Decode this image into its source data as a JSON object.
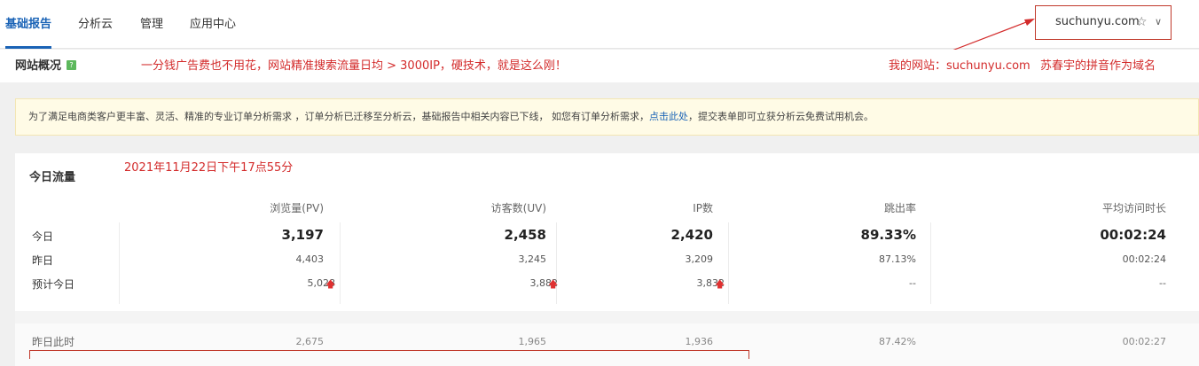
{
  "nav": {
    "tabs": [
      {
        "label": "基础报告",
        "active": true
      },
      {
        "label": "分析云",
        "active": false
      },
      {
        "label": "管理",
        "active": false
      },
      {
        "label": "应用中心",
        "active": false
      }
    ],
    "site_selector": "suchunyu.com"
  },
  "subbar": {
    "title": "网站概况",
    "help_icon": "?",
    "promo": "一分钱广告费也不用花，网站精准搜索流量日均 > 3000IP，硬技术，就是这么刚！",
    "site_note": "我的网站：suchunyu.com",
    "name_note": "苏春宇的拼音作为域名"
  },
  "notice": {
    "text_before": "为了满足电商类客户更丰富、灵活、精准的专业订单分析需求 ，订单分析已迁移至分析云，基础报告中相关内容已下线， 如您有订单分析需求，",
    "link": "点击此处",
    "text_after": "，提交表单即可立获分析云免费试用机会。"
  },
  "panel": {
    "title": "今日流量",
    "timestamp": "2021年11月22日下午17点55分",
    "columns": [
      "浏览量(PV)",
      "访客数(UV)",
      "IP数",
      "跳出率",
      "平均访问时长"
    ],
    "rows": [
      {
        "label": "今日",
        "values": [
          "3,197",
          "2,458",
          "2,420",
          "89.33%",
          "00:02:24"
        ]
      },
      {
        "label": "昨日",
        "values": [
          "4,403",
          "3,245",
          "3,209",
          "87.13%",
          "00:02:24"
        ]
      },
      {
        "label": "预计今日",
        "values": [
          "5,028",
          "3,882",
          "3,832",
          "--",
          "--"
        ],
        "up_arrow": "🡅"
      }
    ],
    "last_row": {
      "label": "昨日此时",
      "values": [
        "2,675",
        "1,965",
        "1,936",
        "87.42%",
        "00:02:27"
      ]
    }
  },
  "colors": {
    "accent": "#1a63b6",
    "annotation": "#d32b2b",
    "up": "#e03030"
  }
}
